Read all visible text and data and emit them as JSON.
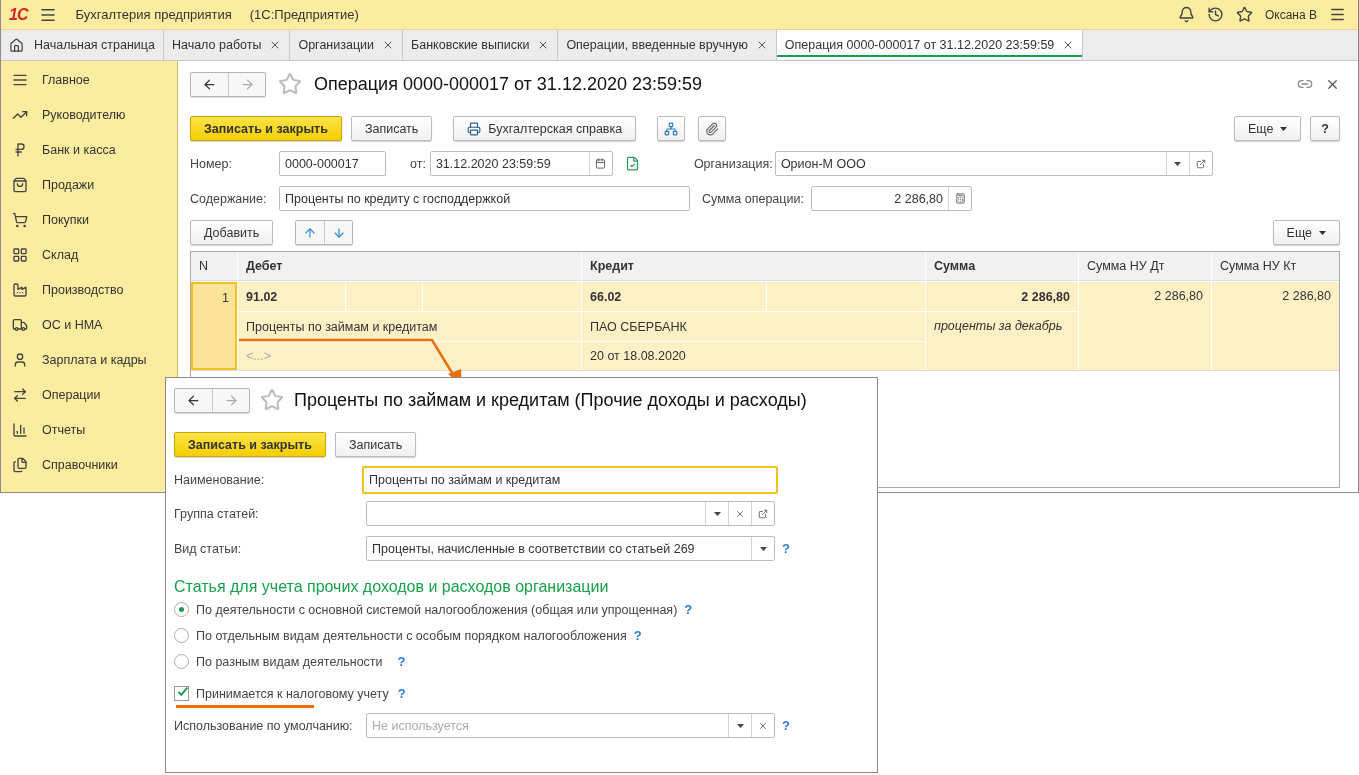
{
  "app": {
    "logo": "1С",
    "title": "Бухгалтерия предприятия",
    "platform": "(1С:Предприятие)",
    "user": "Оксана В"
  },
  "tabs": [
    {
      "label": "Начальная страница",
      "kind": "home",
      "selected": false
    },
    {
      "label": "Начало работы",
      "kind": "doc",
      "selected": false
    },
    {
      "label": "Организации",
      "kind": "doc",
      "selected": false
    },
    {
      "label": "Банковские выписки",
      "kind": "doc",
      "selected": false
    },
    {
      "label": "Операции, введенные вручную",
      "kind": "doc",
      "selected": false
    },
    {
      "label": "Операция 0000-000017 от 31.12.2020 23:59:59",
      "kind": "doc",
      "selected": true
    }
  ],
  "sidebar": [
    {
      "label": "Главное",
      "kind": "main"
    },
    {
      "label": "Руководителю",
      "kind": "manager"
    },
    {
      "label": "Банк и касса",
      "kind": "bank"
    },
    {
      "label": "Продажи",
      "kind": "sales"
    },
    {
      "label": "Покупки",
      "kind": "purchases"
    },
    {
      "label": "Склад",
      "kind": "warehouse"
    },
    {
      "label": "Производство",
      "kind": "production"
    },
    {
      "label": "ОС и НМА",
      "kind": "assets"
    },
    {
      "label": "Зарплата и кадры",
      "kind": "salary"
    },
    {
      "label": "Операции",
      "kind": "operations"
    },
    {
      "label": "Отчеты",
      "kind": "reports"
    },
    {
      "label": "Справочники",
      "kind": "catalogs"
    }
  ],
  "document": {
    "title": "Операция 0000-000017 от 31.12.2020 23:59:59",
    "save_close": "Записать и закрыть",
    "save": "Записать",
    "report": "Бухгалтерская справка",
    "more": "Еще",
    "help": "?",
    "number_label": "Номер:",
    "number": "0000-000017",
    "date_label": "от:",
    "date": "31.12.2020 23:59:59",
    "org_label": "Организация:",
    "org": "Орион-М ООО",
    "content_label": "Содержание:",
    "content": "Проценты по кредиту с господдержкой",
    "sum_label": "Сумма операции:",
    "sum": "2 286,80",
    "add": "Добавить",
    "table_more": "Еще"
  },
  "table": {
    "columns": [
      {
        "label": "N",
        "bold": false
      },
      {
        "label": "Дебет",
        "bold": true
      },
      {
        "label": "Кредит",
        "bold": true
      },
      {
        "label": "Сумма",
        "bold": true
      },
      {
        "label": "Сумма НУ Дт",
        "bold": false
      },
      {
        "label": "Сумма НУ Кт",
        "bold": false
      }
    ],
    "rows": [
      {
        "n": "1",
        "selected": true,
        "debit": [
          "91.02",
          "Проценты по займам и кредитам",
          "<...>"
        ],
        "credit": [
          "66.02",
          "ПАО СБЕРБАНК",
          "20 от 18.08.2020"
        ],
        "sum": "2 286,80",
        "comment": "проценты за декабрь",
        "nu_dt": "2 286,80",
        "nu_kt": "2 286,80"
      }
    ]
  },
  "dialog": {
    "title": "Проценты по займам и кредитам (Прочие доходы и расходы)",
    "save_close": "Записать и закрыть",
    "save": "Записать",
    "name_label": "Наименование:",
    "name": "Проценты по займам и кредитам",
    "group_label": "Группа статей:",
    "type_label": "Вид статьи:",
    "type": "Проценты, начисленные в соответствии со статьей 269",
    "help": "?",
    "section": "Статья для учета прочих доходов и расходов организации",
    "options": [
      {
        "label": "По деятельности с основной системой налогообложения (общая или упрощенная)",
        "selected": true,
        "help": "?"
      },
      {
        "label": "По отдельным видам деятельности с особым порядком налогообложения",
        "selected": false,
        "help": "?"
      },
      {
        "label": "По разным видам деятельности",
        "selected": false,
        "help": "?"
      }
    ],
    "tax": {
      "label": "Принимается к налоговому учету",
      "checked": true,
      "help": "?"
    },
    "usage_label": "Использование по умолчанию:",
    "usage_placeholder": "Не используется",
    "usage_help": "?"
  }
}
